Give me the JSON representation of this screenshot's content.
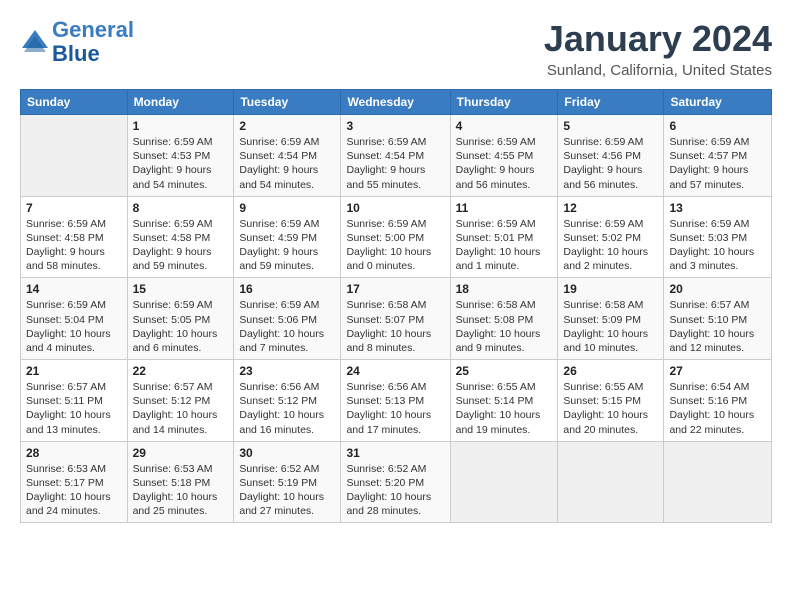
{
  "header": {
    "logo_line1": "General",
    "logo_line2": "Blue",
    "title": "January 2024",
    "subtitle": "Sunland, California, United States"
  },
  "weekdays": [
    "Sunday",
    "Monday",
    "Tuesday",
    "Wednesday",
    "Thursday",
    "Friday",
    "Saturday"
  ],
  "weeks": [
    [
      {
        "day": "",
        "info": ""
      },
      {
        "day": "1",
        "info": "Sunrise: 6:59 AM\nSunset: 4:53 PM\nDaylight: 9 hours\nand 54 minutes."
      },
      {
        "day": "2",
        "info": "Sunrise: 6:59 AM\nSunset: 4:54 PM\nDaylight: 9 hours\nand 54 minutes."
      },
      {
        "day": "3",
        "info": "Sunrise: 6:59 AM\nSunset: 4:54 PM\nDaylight: 9 hours\nand 55 minutes."
      },
      {
        "day": "4",
        "info": "Sunrise: 6:59 AM\nSunset: 4:55 PM\nDaylight: 9 hours\nand 56 minutes."
      },
      {
        "day": "5",
        "info": "Sunrise: 6:59 AM\nSunset: 4:56 PM\nDaylight: 9 hours\nand 56 minutes."
      },
      {
        "day": "6",
        "info": "Sunrise: 6:59 AM\nSunset: 4:57 PM\nDaylight: 9 hours\nand 57 minutes."
      }
    ],
    [
      {
        "day": "7",
        "info": "Sunrise: 6:59 AM\nSunset: 4:58 PM\nDaylight: 9 hours\nand 58 minutes."
      },
      {
        "day": "8",
        "info": "Sunrise: 6:59 AM\nSunset: 4:58 PM\nDaylight: 9 hours\nand 59 minutes."
      },
      {
        "day": "9",
        "info": "Sunrise: 6:59 AM\nSunset: 4:59 PM\nDaylight: 9 hours\nand 59 minutes."
      },
      {
        "day": "10",
        "info": "Sunrise: 6:59 AM\nSunset: 5:00 PM\nDaylight: 10 hours\nand 0 minutes."
      },
      {
        "day": "11",
        "info": "Sunrise: 6:59 AM\nSunset: 5:01 PM\nDaylight: 10 hours\nand 1 minute."
      },
      {
        "day": "12",
        "info": "Sunrise: 6:59 AM\nSunset: 5:02 PM\nDaylight: 10 hours\nand 2 minutes."
      },
      {
        "day": "13",
        "info": "Sunrise: 6:59 AM\nSunset: 5:03 PM\nDaylight: 10 hours\nand 3 minutes."
      }
    ],
    [
      {
        "day": "14",
        "info": "Sunrise: 6:59 AM\nSunset: 5:04 PM\nDaylight: 10 hours\nand 4 minutes."
      },
      {
        "day": "15",
        "info": "Sunrise: 6:59 AM\nSunset: 5:05 PM\nDaylight: 10 hours\nand 6 minutes."
      },
      {
        "day": "16",
        "info": "Sunrise: 6:59 AM\nSunset: 5:06 PM\nDaylight: 10 hours\nand 7 minutes."
      },
      {
        "day": "17",
        "info": "Sunrise: 6:58 AM\nSunset: 5:07 PM\nDaylight: 10 hours\nand 8 minutes."
      },
      {
        "day": "18",
        "info": "Sunrise: 6:58 AM\nSunset: 5:08 PM\nDaylight: 10 hours\nand 9 minutes."
      },
      {
        "day": "19",
        "info": "Sunrise: 6:58 AM\nSunset: 5:09 PM\nDaylight: 10 hours\nand 10 minutes."
      },
      {
        "day": "20",
        "info": "Sunrise: 6:57 AM\nSunset: 5:10 PM\nDaylight: 10 hours\nand 12 minutes."
      }
    ],
    [
      {
        "day": "21",
        "info": "Sunrise: 6:57 AM\nSunset: 5:11 PM\nDaylight: 10 hours\nand 13 minutes."
      },
      {
        "day": "22",
        "info": "Sunrise: 6:57 AM\nSunset: 5:12 PM\nDaylight: 10 hours\nand 14 minutes."
      },
      {
        "day": "23",
        "info": "Sunrise: 6:56 AM\nSunset: 5:12 PM\nDaylight: 10 hours\nand 16 minutes."
      },
      {
        "day": "24",
        "info": "Sunrise: 6:56 AM\nSunset: 5:13 PM\nDaylight: 10 hours\nand 17 minutes."
      },
      {
        "day": "25",
        "info": "Sunrise: 6:55 AM\nSunset: 5:14 PM\nDaylight: 10 hours\nand 19 minutes."
      },
      {
        "day": "26",
        "info": "Sunrise: 6:55 AM\nSunset: 5:15 PM\nDaylight: 10 hours\nand 20 minutes."
      },
      {
        "day": "27",
        "info": "Sunrise: 6:54 AM\nSunset: 5:16 PM\nDaylight: 10 hours\nand 22 minutes."
      }
    ],
    [
      {
        "day": "28",
        "info": "Sunrise: 6:53 AM\nSunset: 5:17 PM\nDaylight: 10 hours\nand 24 minutes."
      },
      {
        "day": "29",
        "info": "Sunrise: 6:53 AM\nSunset: 5:18 PM\nDaylight: 10 hours\nand 25 minutes."
      },
      {
        "day": "30",
        "info": "Sunrise: 6:52 AM\nSunset: 5:19 PM\nDaylight: 10 hours\nand 27 minutes."
      },
      {
        "day": "31",
        "info": "Sunrise: 6:52 AM\nSunset: 5:20 PM\nDaylight: 10 hours\nand 28 minutes."
      },
      {
        "day": "",
        "info": ""
      },
      {
        "day": "",
        "info": ""
      },
      {
        "day": "",
        "info": ""
      }
    ]
  ]
}
